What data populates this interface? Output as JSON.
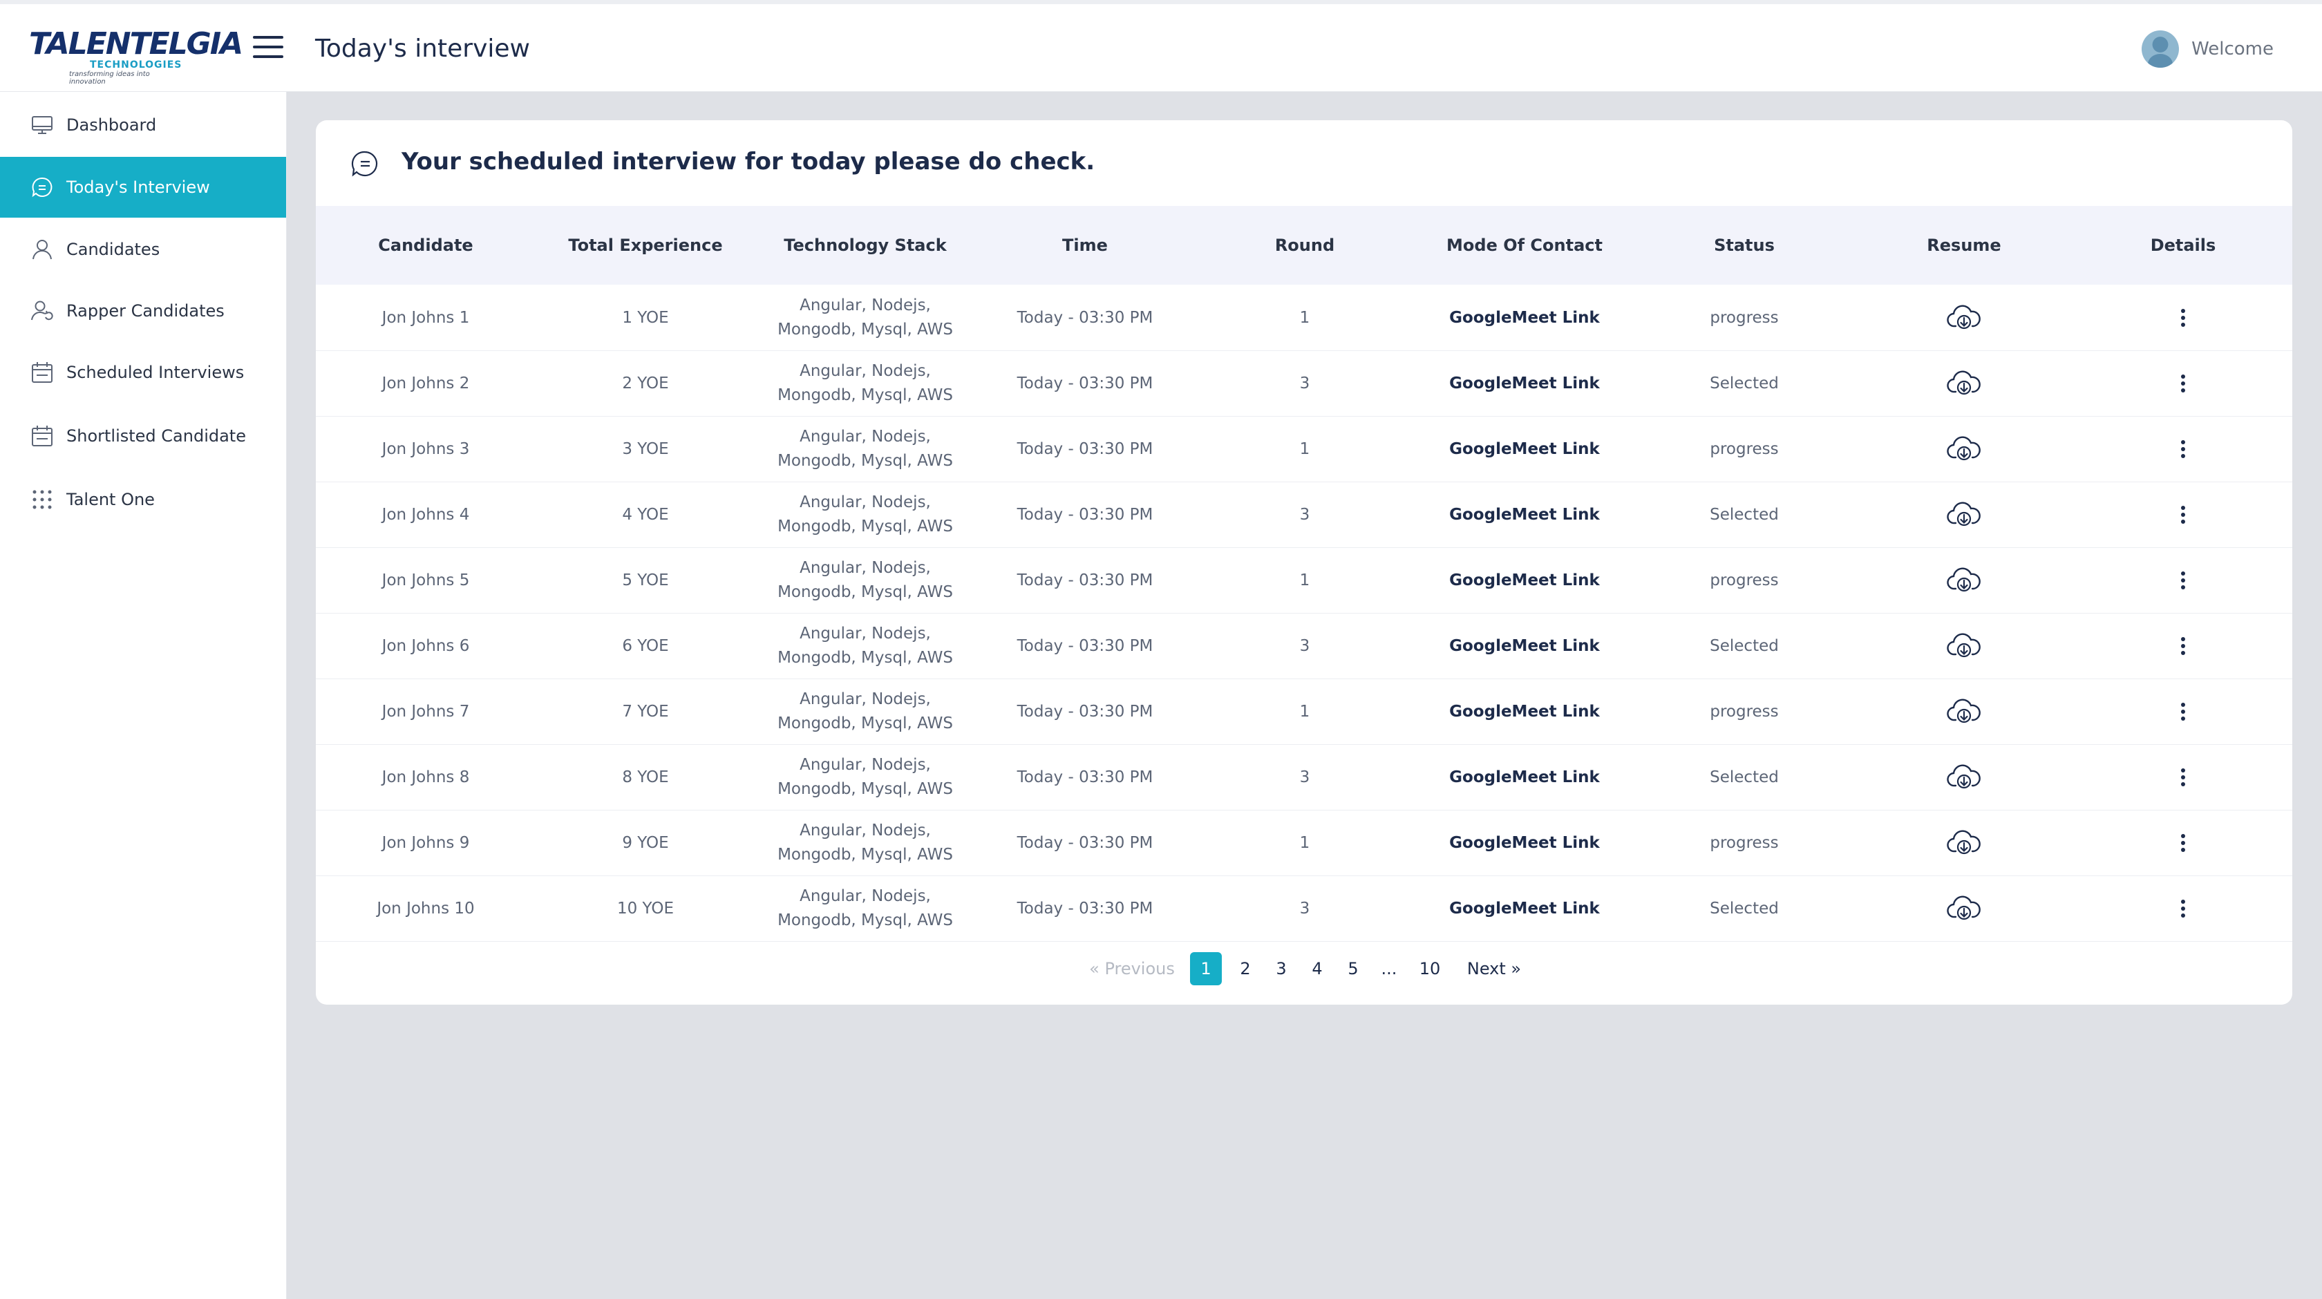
{
  "brand": {
    "logo_text": "TALENTELGIA",
    "logo_sub": "TECHNOLOGIES",
    "logo_tagline": "transforming ideas into innovation"
  },
  "header": {
    "title": "Today's interview",
    "welcome": "Welcome"
  },
  "sidebar": {
    "items": [
      {
        "label": "Dashboard",
        "icon": "monitor-icon",
        "active": false
      },
      {
        "label": "Today's Interview",
        "icon": "chat-icon",
        "active": true
      },
      {
        "label": "Candidates",
        "icon": "user-icon",
        "active": false
      },
      {
        "label": "Rapper Candidates",
        "icon": "user-refresh-icon",
        "active": false
      },
      {
        "label": "Scheduled Interviews",
        "icon": "calendar-icon",
        "active": false
      },
      {
        "label": "Shortlisted Candidate",
        "icon": "calendar-icon",
        "active": false
      },
      {
        "label": "Talent One",
        "icon": "grid-dots-icon",
        "active": false
      }
    ]
  },
  "main": {
    "card_title": "Your scheduled interview for today please do check.",
    "columns": [
      "Candidate",
      "Total Experience",
      "Technology Stack",
      "Time",
      "Round",
      "Mode Of Contact",
      "Status",
      "Resume",
      "Details"
    ],
    "rows": [
      {
        "candidate": "Jon Johns 1",
        "experience": "1 YOE",
        "stack1": "Angular, Nodejs,",
        "stack2": "Mongodb, Mysql, AWS",
        "time": "Today - 03:30 PM",
        "round": "1",
        "contact": "GoogleMeet Link",
        "status": "progress"
      },
      {
        "candidate": "Jon Johns 2",
        "experience": "2 YOE",
        "stack1": "Angular, Nodejs,",
        "stack2": "Mongodb, Mysql, AWS",
        "time": "Today - 03:30 PM",
        "round": "3",
        "contact": "GoogleMeet Link",
        "status": "Selected"
      },
      {
        "candidate": "Jon Johns 3",
        "experience": "3 YOE",
        "stack1": "Angular, Nodejs,",
        "stack2": "Mongodb, Mysql, AWS",
        "time": "Today - 03:30 PM",
        "round": "1",
        "contact": "GoogleMeet Link",
        "status": "progress"
      },
      {
        "candidate": "Jon Johns 4",
        "experience": "4 YOE",
        "stack1": "Angular, Nodejs,",
        "stack2": "Mongodb, Mysql, AWS",
        "time": "Today - 03:30 PM",
        "round": "3",
        "contact": "GoogleMeet Link",
        "status": "Selected"
      },
      {
        "candidate": "Jon Johns 5",
        "experience": "5 YOE",
        "stack1": "Angular, Nodejs,",
        "stack2": "Mongodb, Mysql, AWS",
        "time": "Today - 03:30 PM",
        "round": "1",
        "contact": "GoogleMeet Link",
        "status": "progress"
      },
      {
        "candidate": "Jon Johns 6",
        "experience": "6 YOE",
        "stack1": "Angular, Nodejs,",
        "stack2": "Mongodb, Mysql, AWS",
        "time": "Today - 03:30 PM",
        "round": "3",
        "contact": "GoogleMeet Link",
        "status": "Selected"
      },
      {
        "candidate": "Jon Johns 7",
        "experience": "7 YOE",
        "stack1": "Angular, Nodejs,",
        "stack2": "Mongodb, Mysql, AWS",
        "time": "Today - 03:30 PM",
        "round": "1",
        "contact": "GoogleMeet Link",
        "status": "progress"
      },
      {
        "candidate": "Jon Johns 8",
        "experience": "8 YOE",
        "stack1": "Angular, Nodejs,",
        "stack2": "Mongodb, Mysql, AWS",
        "time": "Today - 03:30 PM",
        "round": "3",
        "contact": "GoogleMeet Link",
        "status": "Selected"
      },
      {
        "candidate": "Jon Johns 9",
        "experience": "9 YOE",
        "stack1": "Angular, Nodejs,",
        "stack2": "Mongodb, Mysql, AWS",
        "time": "Today - 03:30 PM",
        "round": "1",
        "contact": "GoogleMeet Link",
        "status": "progress"
      },
      {
        "candidate": "Jon Johns 10",
        "experience": "10 YOE",
        "stack1": "Angular, Nodejs,",
        "stack2": "Mongodb, Mysql, AWS",
        "time": "Today - 03:30 PM",
        "round": "3",
        "contact": "GoogleMeet Link",
        "status": "Selected"
      }
    ],
    "resume_icon": "cloud-download-icon",
    "details_icon": "more-vertical-icon"
  },
  "pagination": {
    "previous": "«  Previous",
    "next": "Next  »",
    "pages": [
      "1",
      "2",
      "3",
      "4",
      "5",
      "...",
      "10"
    ],
    "current": "1"
  },
  "colors": {
    "accent": "#16aec7",
    "navy": "#1d2b4a",
    "background": "#dfe1e6"
  }
}
